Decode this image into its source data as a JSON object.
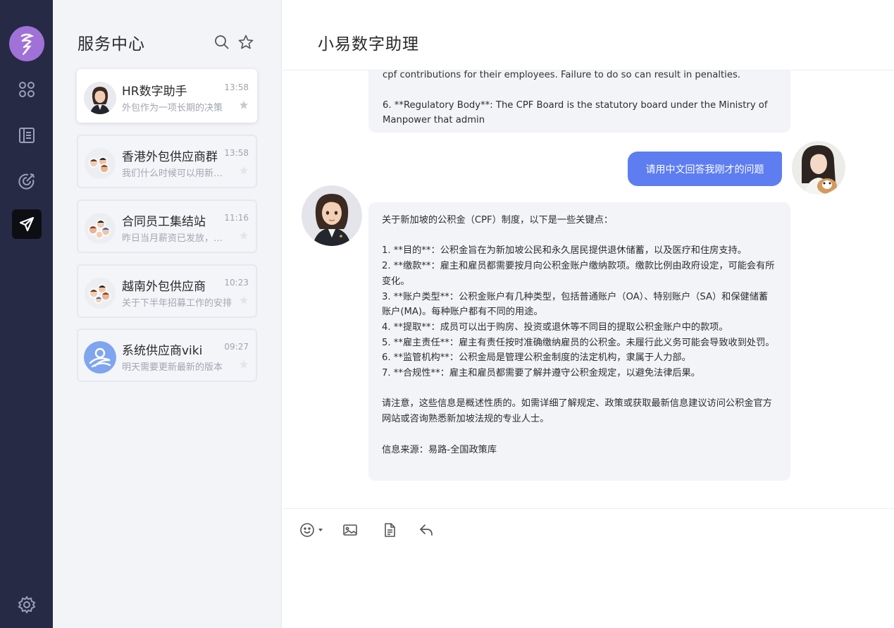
{
  "sidebar": {
    "nav_items": [
      "apps",
      "records",
      "target",
      "messages"
    ],
    "active_item": "messages"
  },
  "conversation_list": {
    "title": "服务中心",
    "items": [
      {
        "name": "HR数字助手",
        "time": "13:58",
        "preview": "外包作为一项长期的决策",
        "active": true
      },
      {
        "name": "香港外包供应商群",
        "time": "13:58",
        "preview": "我们什么时候可以用新的系统",
        "active": false
      },
      {
        "name": "合同员工集结站",
        "time": "11:16",
        "preview": "昨日当月薪资已发放，请查收",
        "active": false
      },
      {
        "name": "越南外包供应商",
        "time": "10:23",
        "preview": "关于下半年招募工作的安排",
        "active": false
      },
      {
        "name": "系统供应商viki",
        "time": "09:27",
        "preview": "明天需要更新最新的版本",
        "active": false
      }
    ]
  },
  "chat": {
    "title": "小易数字助理",
    "top_message": {
      "line1": "cpf contributions for their employees. Failure to do so can result in penalties.",
      "line2": "6. **Regulatory Body**: The CPF Board is the statutory board under the Ministry of Manpower that admin"
    },
    "user_message": "请用中文回答我刚才的问题",
    "bot_message": "关于新加坡的公积金（CPF）制度，以下是一些关键点：\n\n1. **目的**：公积金旨在为新加坡公民和永久居民提供退休储蓄，以及医疗和住房支持。\n2. **缴款**：雇主和雇员都需要按月向公积金账户缴纳款项。缴款比例由政府设定，可能会有所变化。\n3. **账户类型**：公积金账户有几种类型，包括普通账户（OA）、特别账户（SA）和保健储蓄账户(MA)。每种账户都有不同的用途。\n4. **提取**：成员可以出于购房、投资或退休等不同目的提取公积金账户中的款项。\n5. **雇主责任**：雇主有责任按时准确缴纳雇员的公积金。未履行此义务可能会导致收到处罚。\n6. **监管机构**：公积金局是管理公积金制度的法定机构，隶属于人力部。\n7. **合规性**：雇主和雇员都需要了解并遵守公积金规定，以避免法律后果。\n\n请注意，这些信息是概述性质的。如需详细了解规定、政策或获取最新信息建议访问公积金官方网站或咨询熟悉新加坡法规的专业人士。\n\n信息来源：易路-全国政策库"
  },
  "composer": {
    "tools": [
      "emoji-icon",
      "image-icon",
      "file-icon",
      "reply-icon"
    ]
  },
  "colors": {
    "rail_bg": "#262a45",
    "logo_bg": "#a072d8",
    "user_bubble": "#5d7df0",
    "bot_bubble": "#f3f4f8"
  }
}
